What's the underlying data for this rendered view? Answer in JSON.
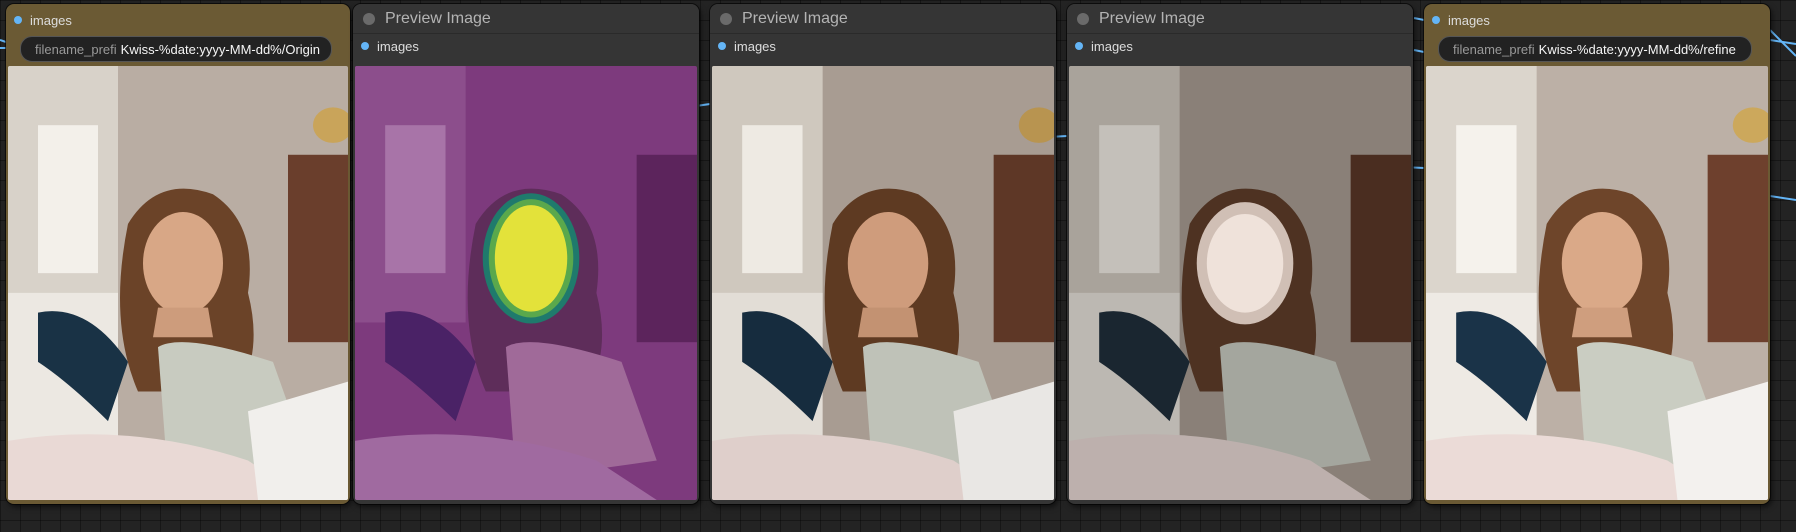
{
  "nodes": [
    {
      "kind": "save",
      "slot_label": "images",
      "widget_label": "filename_prefi",
      "widget_value": "Kwiss-%date:yyyy-MM-dd%/Origin",
      "image": "original"
    },
    {
      "kind": "preview",
      "title": "Preview Image",
      "slot_label": "images",
      "image": "mask-overlay"
    },
    {
      "kind": "preview",
      "title": "Preview Image",
      "slot_label": "images",
      "image": "cropped"
    },
    {
      "kind": "preview",
      "title": "Preview Image",
      "slot_label": "images",
      "image": "face-highlight"
    },
    {
      "kind": "save",
      "slot_label": "images",
      "widget_label": "filename_prefi",
      "widget_value": "Kwiss-%date:yyyy-MM-dd%/refine",
      "image": "refined"
    }
  ],
  "colors": {
    "canvas": "#232323",
    "save_node": "#6b5a34",
    "preview_node": "#353535",
    "link": "#64b5f6",
    "mask_purple": "#7d3a7d",
    "mask_yellow": "#e3e23a"
  }
}
